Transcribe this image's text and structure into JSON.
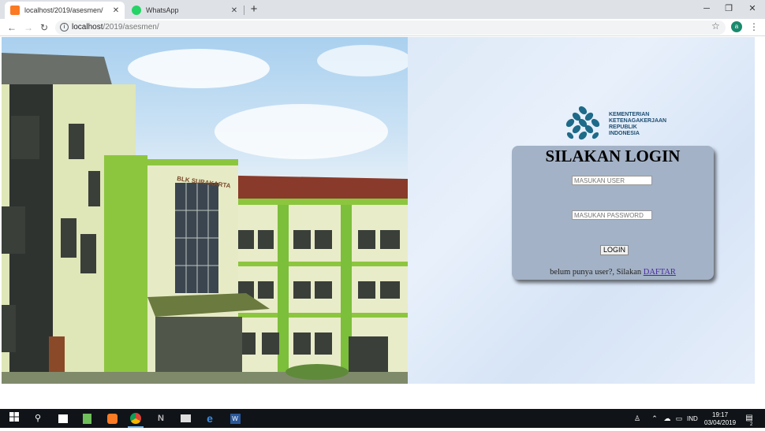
{
  "browser": {
    "tabs": [
      {
        "title": "localhost/2019/asesmen/",
        "icon": "xampp-icon",
        "active": true
      },
      {
        "title": "WhatsApp",
        "icon": "whatsapp-icon",
        "active": false
      }
    ],
    "new_tab_label": "+",
    "address": {
      "host": "localhost",
      "path": "/2019/asesmen/"
    },
    "profile_initial": "a"
  },
  "logo": {
    "lines": [
      "KEMENTERIAN",
      "KETENAGAKERJAAN",
      "REPUBLIK",
      "INDONESIA"
    ]
  },
  "hero": {
    "building_sign": "BLK SURAKARTA"
  },
  "login": {
    "title": "SILAKAN LOGIN",
    "user_placeholder": "MASUKAN USER",
    "password_placeholder": "MASUKAN PASSWORD",
    "button_label": "LOGIN",
    "register_prompt": "belum punya user?, Silakan",
    "register_link": "DAFTAR"
  },
  "taskbar": {
    "language": "IND",
    "time": "19:17",
    "date": "03/04/2019",
    "notification_count": "2"
  },
  "colors": {
    "panel": "#a3b2c6",
    "logo_blue": "#1d4e72",
    "link": "#4a2aa5",
    "building_green": "#8cc63f"
  }
}
